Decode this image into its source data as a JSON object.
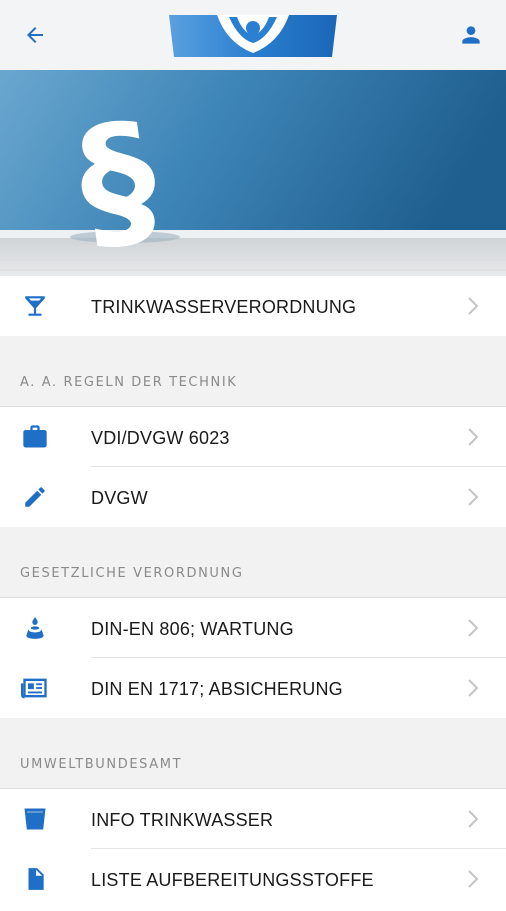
{
  "header": {
    "back_icon": "arrow-left-icon",
    "logo": "brand-logo",
    "account_icon": "person-icon",
    "accent_color": "#1f6fc6"
  },
  "hero": {
    "symbol": "§"
  },
  "sections": [
    {
      "title": "",
      "items": [
        {
          "label": "TRINKWASSERVERORDNUNG",
          "icon": "cocktail-glass-icon"
        }
      ]
    },
    {
      "title": "A. A. REGELN DER TECHNIK",
      "items": [
        {
          "label": "VDI/DVGW 6023",
          "icon": "briefcase-icon"
        },
        {
          "label": "DVGW",
          "icon": "pencil-icon"
        }
      ]
    },
    {
      "title": "GESETZLICHE VERORDNUNG",
      "items": [
        {
          "label": "DIN-EN 806; WARTUNG",
          "icon": "water-drop-icon"
        },
        {
          "label": "DIN EN 1717; ABSICHERUNG",
          "icon": "newspaper-icon"
        }
      ]
    },
    {
      "title": "UMWELTBUNDESAMT",
      "items": [
        {
          "label": "INFO TRINKWASSER",
          "icon": "cup-icon"
        },
        {
          "label": "LISTE AUFBEREITUNGSSTOFFE",
          "icon": "document-icon"
        }
      ]
    }
  ]
}
